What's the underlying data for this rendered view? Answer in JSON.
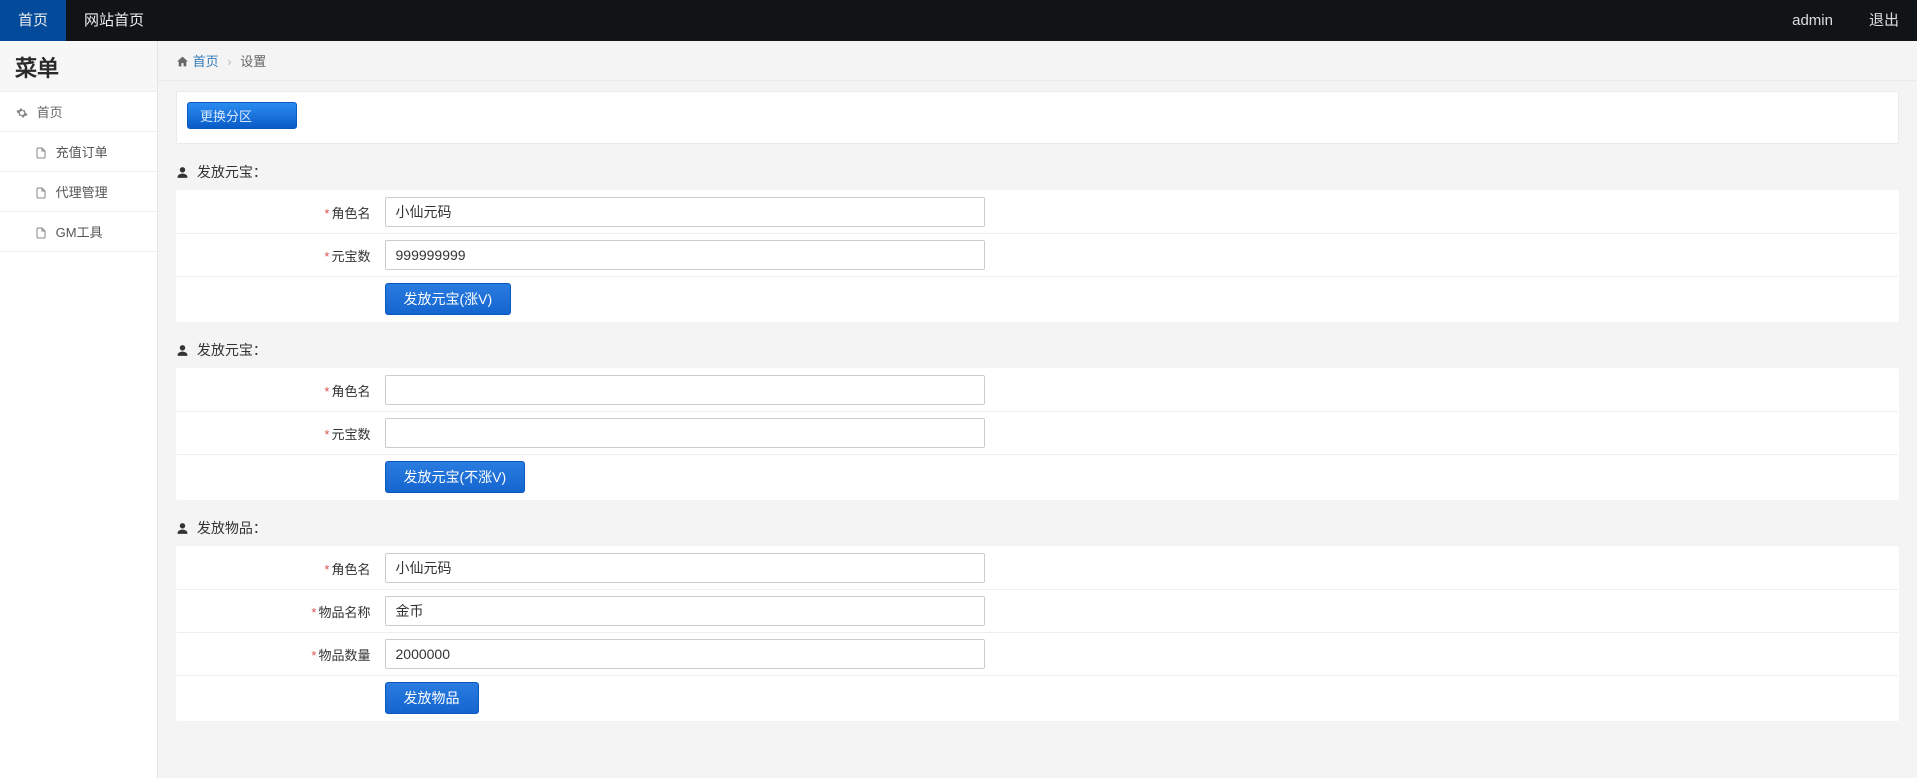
{
  "topbar": {
    "home": "首页",
    "site_home": "网站首页",
    "user": "admin",
    "logout": "退出"
  },
  "sidebar": {
    "title": "菜单",
    "group": "首页",
    "items": [
      "充值订单",
      "代理管理",
      "GM工具"
    ]
  },
  "breadcrumb": {
    "home": "首页",
    "current": "设置"
  },
  "change_zone": "更换分区",
  "sections": [
    {
      "title": "发放元宝：",
      "rows": [
        {
          "label": "角色名",
          "value": "小仙元码"
        },
        {
          "label": "元宝数",
          "value": "999999999"
        }
      ],
      "button": "发放元宝(涨V)"
    },
    {
      "title": "发放元宝：",
      "rows": [
        {
          "label": "角色名",
          "value": ""
        },
        {
          "label": "元宝数",
          "value": ""
        }
      ],
      "button": "发放元宝(不涨V)"
    },
    {
      "title": "发放物品：",
      "rows": [
        {
          "label": "角色名",
          "value": "小仙元码"
        },
        {
          "label": "物品名称",
          "value": "金币"
        },
        {
          "label": "物品数量",
          "value": "2000000"
        }
      ],
      "button": "发放物品"
    }
  ]
}
